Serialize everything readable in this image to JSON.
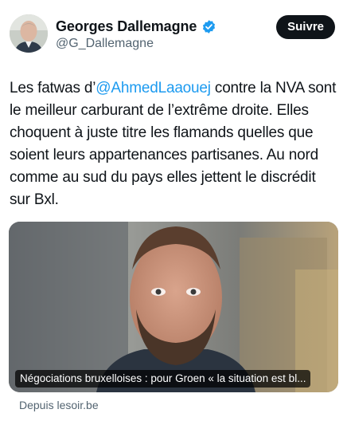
{
  "author": {
    "display_name": "Georges Dallemagne",
    "handle": "@G_Dallemagne",
    "verified_icon": "verified-badge-icon"
  },
  "actions": {
    "follow_label": "Suivre"
  },
  "tweet": {
    "text_before": "Les fatwas d’",
    "mention": "@AhmedLaaouej",
    "text_after": " contre la NVA sont le meilleur carburant de l’extrême droite. Elles choquent à juste titre les flamands quelles que soient leurs appartenances partisanes. Au nord comme au sud du pays elles jettent le discrédit sur Bxl."
  },
  "link_card": {
    "caption": "Négociations bruxelloises : pour Groen « la situation est bl...",
    "source": "Depuis lesoir.be"
  },
  "colors": {
    "link": "#1d9bf0",
    "secondary_text": "#536471",
    "button_bg": "#0f1419"
  }
}
